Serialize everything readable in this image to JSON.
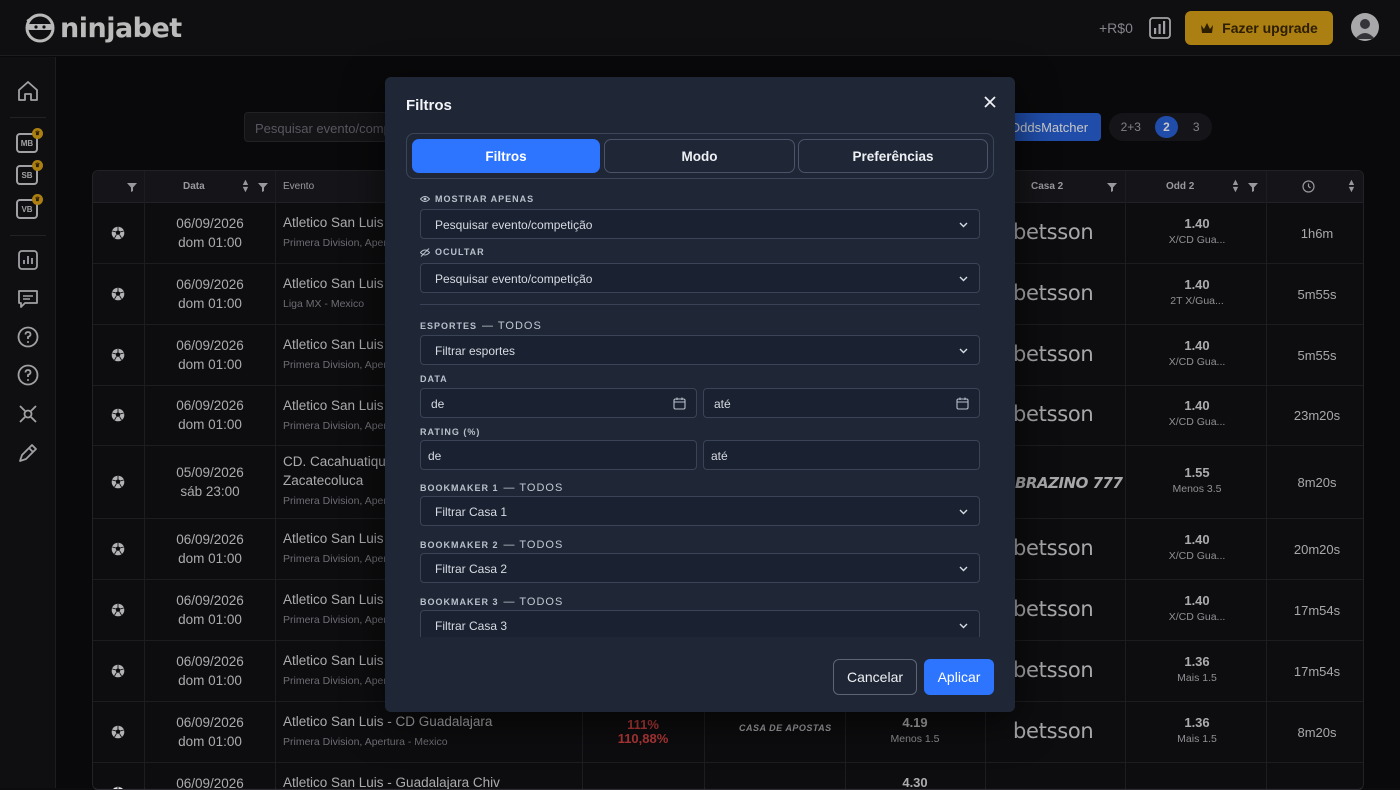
{
  "brand": {
    "name": "ninjabet"
  },
  "header": {
    "balance": "+R$0",
    "upgrade_label": "Fazer upgrade"
  },
  "sidebar": {
    "badges": [
      "MB",
      "SB",
      "VB"
    ]
  },
  "toolbar": {
    "search_text": "Pesquisar evento/comp",
    "oddsmatcher_label": "OddsMatcher",
    "segments": [
      "2+3",
      "2",
      "3"
    ],
    "selected_segment": "2"
  },
  "table": {
    "headers": {
      "data": "Data",
      "evento": "Evento",
      "casa2": "Casa 2",
      "odd2": "Odd 2"
    },
    "rows": [
      {
        "date": "06/09/2026",
        "time": "dom 01:00",
        "event": "Atletico San Luis -",
        "event_line2": "",
        "league": "Primera Division, Aper",
        "bookmaker": "betsson",
        "odd": "1.40",
        "market": "X/CD Gua...",
        "elapsed": "1h6m"
      },
      {
        "date": "06/09/2026",
        "time": "dom 01:00",
        "event": "Atletico San Luis -",
        "event_line2": "",
        "league": "Liga MX - Mexico",
        "bookmaker": "betsson",
        "odd": "1.40",
        "market": "2T X/Gua...",
        "elapsed": "5m55s"
      },
      {
        "date": "06/09/2026",
        "time": "dom 01:00",
        "event": "Atletico San Luis -",
        "event_line2": "",
        "league": "Primera Division, Aper",
        "bookmaker": "betsson",
        "odd": "1.40",
        "market": "X/CD Gua...",
        "elapsed": "5m55s"
      },
      {
        "date": "06/09/2026",
        "time": "dom 01:00",
        "event": "Atletico San Luis -",
        "event_line2": "",
        "league": "Primera Division, Aper",
        "bookmaker": "betsson",
        "odd": "1.40",
        "market": "X/CD Gua...",
        "elapsed": "23m20s"
      },
      {
        "date": "05/09/2026",
        "time": "sáb 23:00",
        "event": "CD. Cacahuatique",
        "event_line2": "Zacatecoluca",
        "league": "Primera Division, Aper",
        "bookmaker": "BRAZINO 777",
        "odd": "1.55",
        "market": "Menos 3.5",
        "elapsed": "8m20s"
      },
      {
        "date": "06/09/2026",
        "time": "dom 01:00",
        "event": "Atletico San Luis -",
        "event_line2": "",
        "league": "Primera Division, Aper",
        "bookmaker": "betsson",
        "odd": "1.40",
        "market": "X/CD Gua...",
        "elapsed": "20m20s"
      },
      {
        "date": "06/09/2026",
        "time": "dom 01:00",
        "event": "Atletico San Luis -",
        "event_line2": "",
        "league": "Primera Division, Aper",
        "bookmaker": "betsson",
        "odd": "1.40",
        "market": "X/CD Gua...",
        "elapsed": "17m54s"
      },
      {
        "date": "06/09/2026",
        "time": "dom 01:00",
        "event": "Atletico San Luis -",
        "event_line2": "",
        "league": "Primera Division, Aper",
        "bookmaker": "betsson",
        "odd": "1.36",
        "market": "Mais 1.5",
        "elapsed": "17m54s"
      },
      {
        "date": "06/09/2026",
        "time": "dom 01:00",
        "event": "Atletico San Luis - CD Guadalajara",
        "event_line2": "",
        "league": "Primera Division, Apertura - Mexico",
        "bookmaker": "betsson",
        "odd": "1.36",
        "market": "Mais 1.5",
        "elapsed": "8m20s",
        "rating": "111%",
        "rating2": "110,88%",
        "bookmaker1": "CASA DE APOSTAS",
        "odd1": "4.19",
        "market1": "Menos 1.5"
      },
      {
        "date": "06/09/2026",
        "time": "",
        "event": "Atletico San Luis - Guadalajara Chiv",
        "event_line2": "",
        "league": "",
        "bookmaker": "",
        "odd": "",
        "market": "",
        "elapsed": "",
        "odd1": "4.30"
      }
    ]
  },
  "modal": {
    "title": "Filtros",
    "tabs": [
      "Filtros",
      "Modo",
      "Preferências"
    ],
    "active_tab": "Filtros",
    "show_only_label": "MOSTRAR APENAS",
    "show_only_value": "Pesquisar evento/competição",
    "hide_label": "OCULTAR",
    "hide_value": "Pesquisar evento/competição",
    "sports_label": "ESPORTES",
    "todos": "— TODOS",
    "sports_value": "Filtrar esportes",
    "date_label": "DATA",
    "date_from": "de",
    "date_to": "até",
    "rating_label": "RATING (%)",
    "rating_from": "de",
    "rating_to": "até",
    "bm1_label": "BOOKMAKER 1",
    "bm1_value": "Filtrar Casa 1",
    "bm2_label": "BOOKMAKER 2",
    "bm2_value": "Filtrar Casa 2",
    "bm3_label": "BOOKMAKER 3",
    "bm3_value": "Filtrar Casa 3",
    "cancel_label": "Cancelar",
    "apply_label": "Aplicar"
  },
  "colors": {
    "accent": "#2d74ff",
    "upgrade": "#dba317",
    "rating": "#e64747",
    "modal_bg": "#1f2736"
  }
}
